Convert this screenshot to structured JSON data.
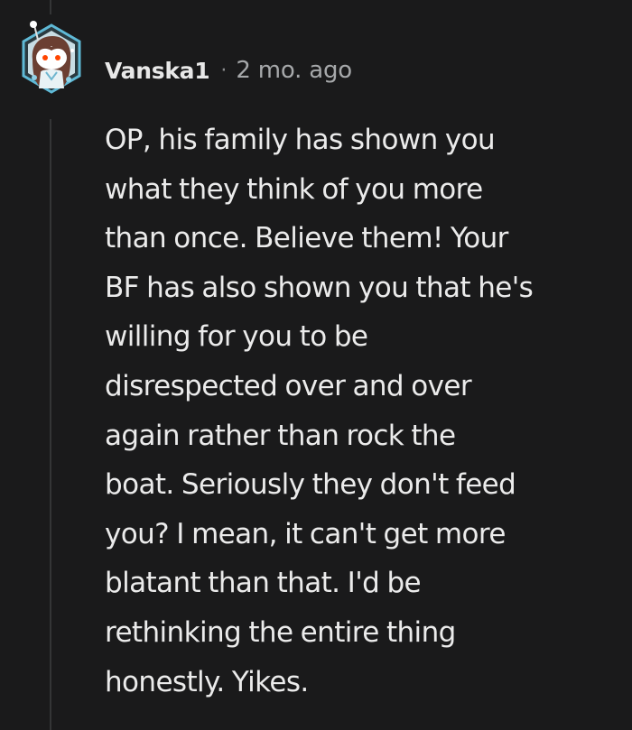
{
  "comment": {
    "author": "Vanska1",
    "separator": "·",
    "timestamp": "2 mo. ago",
    "avatar_icon": "snoo-avatar-icon",
    "body_lines": [
      "OP, his family has shown you",
      "what they think of you more",
      "than once. Believe them! Your",
      "BF has also shown you that he's",
      "willing for you to be",
      "disrespected over and over",
      "again rather than rock the",
      "boat. Seriously they don't feed",
      "you? I mean, it can't get more",
      "blatant than that. I'd be",
      "rethinking the entire thing",
      "honestly. Yikes."
    ]
  },
  "colors": {
    "background": "#1a1a1b",
    "text": "#ebebeb",
    "meta_text": "#a6a8aa",
    "thread_line": "#343536",
    "avatar_frame": "#5fb9d6",
    "avatar_eyes": "#ff4500"
  }
}
